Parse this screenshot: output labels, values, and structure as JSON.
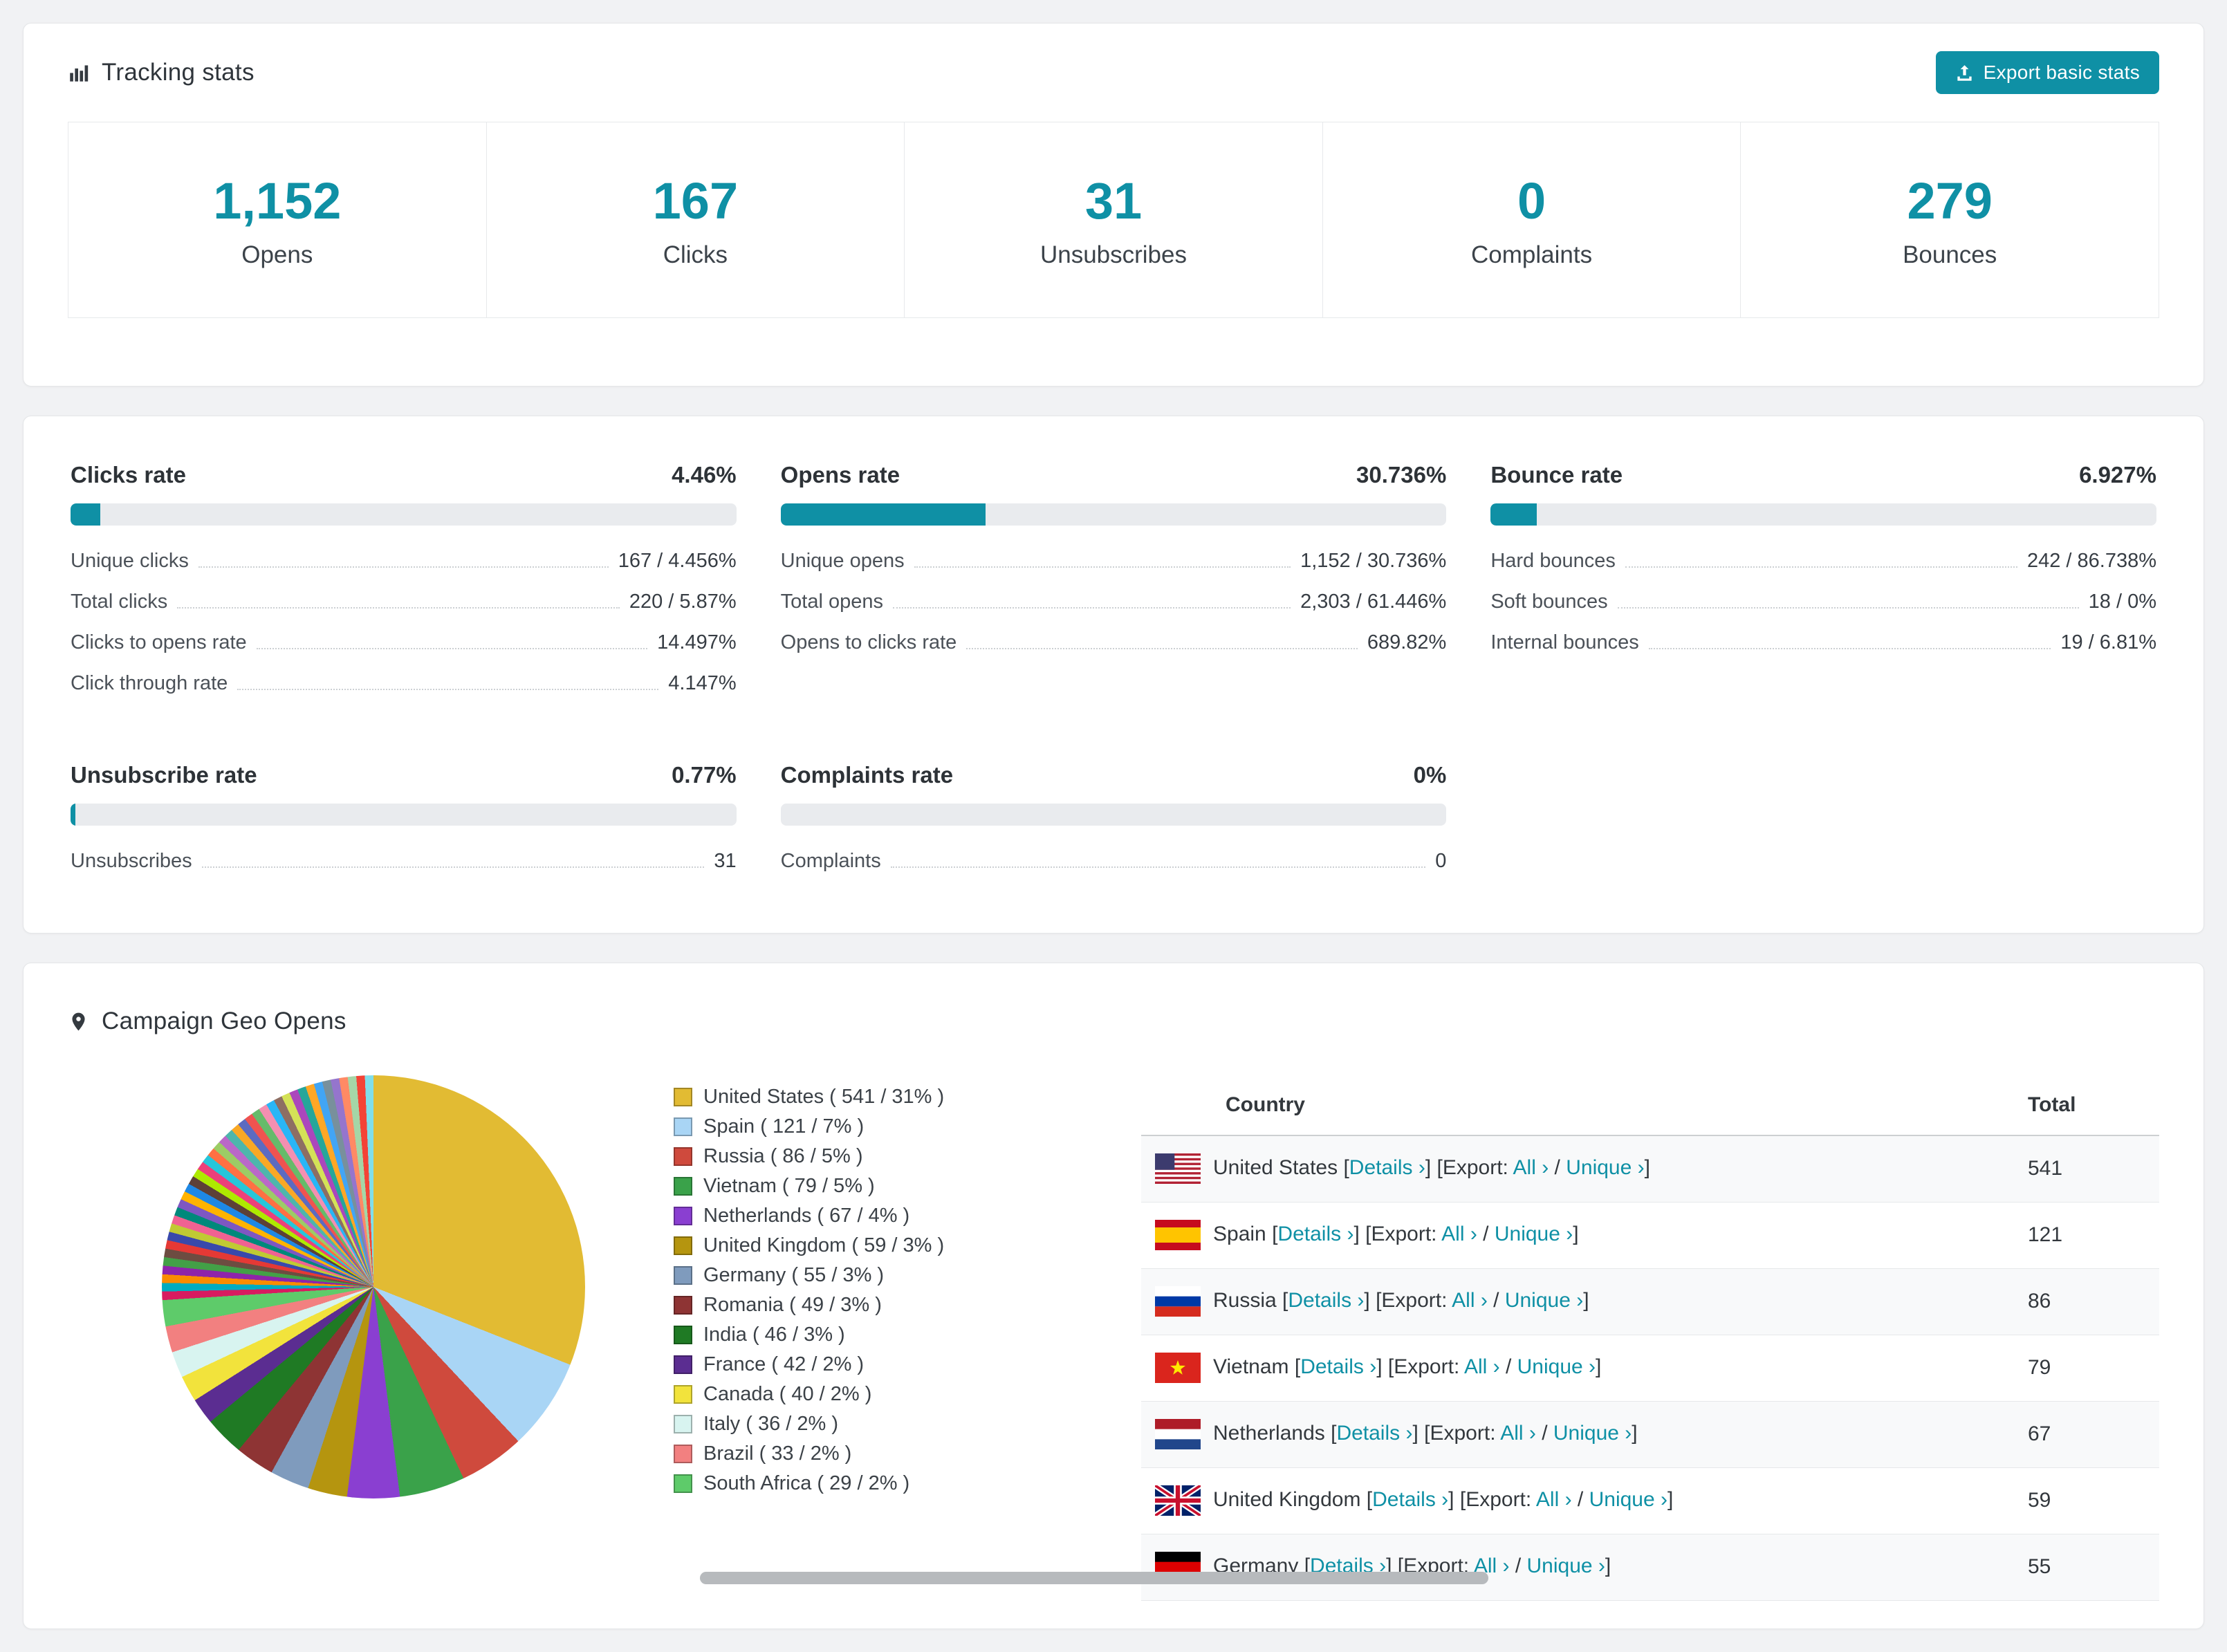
{
  "page": {
    "accent": "#0f90a5"
  },
  "tracking": {
    "title": "Tracking stats",
    "export_button": "Export basic stats",
    "stats": [
      {
        "value": "1,152",
        "label": "Opens"
      },
      {
        "value": "167",
        "label": "Clicks"
      },
      {
        "value": "31",
        "label": "Unsubscribes"
      },
      {
        "value": "0",
        "label": "Complaints"
      },
      {
        "value": "279",
        "label": "Bounces"
      }
    ]
  },
  "rates": [
    {
      "title": "Clicks rate",
      "value": "4.46%",
      "percent": 4.46,
      "rows": [
        {
          "label": "Unique clicks",
          "value": "167 / 4.456%"
        },
        {
          "label": "Total clicks",
          "value": "220 / 5.87%"
        },
        {
          "label": "Clicks to opens rate",
          "value": "14.497%"
        },
        {
          "label": "Click through rate",
          "value": "4.147%"
        }
      ]
    },
    {
      "title": "Opens rate",
      "value": "30.736%",
      "percent": 30.736,
      "rows": [
        {
          "label": "Unique opens",
          "value": "1,152 / 30.736%"
        },
        {
          "label": "Total opens",
          "value": "2,303 / 61.446%"
        },
        {
          "label": "Opens to clicks rate",
          "value": "689.82%"
        }
      ]
    },
    {
      "title": "Bounce rate",
      "value": "6.927%",
      "percent": 6.927,
      "rows": [
        {
          "label": "Hard bounces",
          "value": "242 / 86.738%"
        },
        {
          "label": "Soft bounces",
          "value": "18 / 0%"
        },
        {
          "label": "Internal bounces",
          "value": "19 / 6.81%"
        }
      ]
    },
    {
      "title": "Unsubscribe rate",
      "value": "0.77%",
      "percent": 0.77,
      "rows": [
        {
          "label": "Unsubscribes",
          "value": "31"
        }
      ]
    },
    {
      "title": "Complaints rate",
      "value": "0%",
      "percent": 0,
      "rows": [
        {
          "label": "Complaints",
          "value": "0"
        }
      ]
    }
  ],
  "geo": {
    "title": "Campaign Geo Opens",
    "table": {
      "headers": {
        "country": "Country",
        "total": "Total"
      },
      "details_label": "Details",
      "export_label": "Export:",
      "all_label": "All",
      "unique_label": "Unique",
      "chevron": "›",
      "rows": [
        {
          "country": "United States",
          "flag": "us",
          "total": "541"
        },
        {
          "country": "Spain",
          "flag": "es",
          "total": "121"
        },
        {
          "country": "Russia",
          "flag": "ru",
          "total": "86"
        },
        {
          "country": "Vietnam",
          "flag": "vn",
          "total": "79"
        },
        {
          "country": "Netherlands",
          "flag": "nl",
          "total": "67"
        },
        {
          "country": "United Kingdom",
          "flag": "gb",
          "total": "59"
        },
        {
          "country": "Germany",
          "flag": "de",
          "total": "55"
        }
      ]
    }
  },
  "chart_data": {
    "type": "pie",
    "title": "Campaign Geo Opens",
    "legend_position": "right",
    "slices": [
      {
        "name": "United States",
        "value": 541,
        "percent": 31,
        "color": "#e2bb33"
      },
      {
        "name": "Spain",
        "value": 121,
        "percent": 7,
        "color": "#a9d5f5"
      },
      {
        "name": "Russia",
        "value": 86,
        "percent": 5,
        "color": "#cf4a3d"
      },
      {
        "name": "Vietnam",
        "value": 79,
        "percent": 5,
        "color": "#3aa24a"
      },
      {
        "name": "Netherlands",
        "value": 67,
        "percent": 4,
        "color": "#8a3fd1"
      },
      {
        "name": "United Kingdom",
        "value": 59,
        "percent": 3,
        "color": "#b5950f"
      },
      {
        "name": "Germany",
        "value": 55,
        "percent": 3,
        "color": "#7f9bbd"
      },
      {
        "name": "Romania",
        "value": 49,
        "percent": 3,
        "color": "#8e3434"
      },
      {
        "name": "India",
        "value": 46,
        "percent": 3,
        "color": "#1f7a24"
      },
      {
        "name": "France",
        "value": 42,
        "percent": 2,
        "color": "#5b2d91"
      },
      {
        "name": "Canada",
        "value": 40,
        "percent": 2,
        "color": "#f2e33c"
      },
      {
        "name": "Italy",
        "value": 36,
        "percent": 2,
        "color": "#d8f4f0"
      },
      {
        "name": "Brazil",
        "value": 33,
        "percent": 2,
        "color": "#f28080"
      },
      {
        "name": "South Africa",
        "value": 29,
        "percent": 2,
        "color": "#5ecb6a"
      }
    ],
    "others": {
      "percent": 26,
      "colors": [
        "#d81b60",
        "#00acc1",
        "#fb8c00",
        "#8e24aa",
        "#43a047",
        "#6d4c41",
        "#e53935",
        "#3949ab",
        "#c0ca33",
        "#f06292",
        "#00897b",
        "#7e57c2",
        "#ffb300",
        "#1e88e5",
        "#5d4037",
        "#aeea00",
        "#ec407a",
        "#26c6da",
        "#ff7043",
        "#9ccc65",
        "#ba68c8",
        "#4db6ac",
        "#f9a825",
        "#5c6bc0",
        "#ef5350",
        "#66bb6a",
        "#f48fb1",
        "#29b6f6",
        "#8d6e63",
        "#d4e157",
        "#ab47bc",
        "#26a69a",
        "#ffa726",
        "#42a5f5",
        "#78909c",
        "#9575cd",
        "#ff8a65",
        "#a5d6a7",
        "#f44336",
        "#80deea"
      ]
    }
  }
}
